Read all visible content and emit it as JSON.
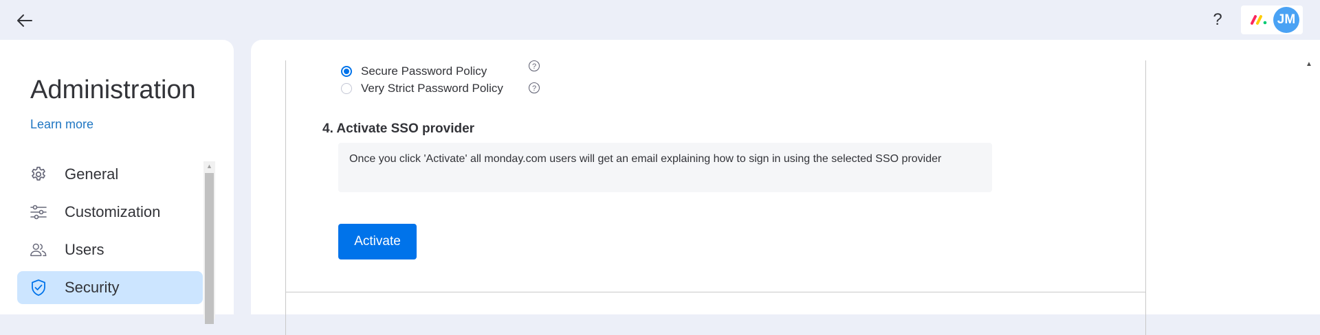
{
  "topbar": {
    "help_label": "?",
    "avatar_initials": "JM"
  },
  "sidebar": {
    "title": "Administration",
    "learn_more": "Learn more",
    "items": [
      {
        "label": "General",
        "icon": "gear-icon"
      },
      {
        "label": "Customization",
        "icon": "sliders-icon"
      },
      {
        "label": "Users",
        "icon": "users-icon"
      },
      {
        "label": "Security",
        "icon": "shield-icon",
        "active": true
      }
    ]
  },
  "main": {
    "password_options": [
      {
        "label": "Secure Password Policy",
        "selected": true
      },
      {
        "label": "Very Strict Password Policy",
        "selected": false
      }
    ],
    "step_title": "4. Activate SSO provider",
    "notice": "Once you click 'Activate' all monday.com users will get an email explaining how to sign in using the selected SSO provider",
    "activate_label": "Activate"
  },
  "colors": {
    "accent": "#0073ea",
    "active_nav_bg": "#cce5ff",
    "page_bg": "#eceff8",
    "avatar_bg": "#4aa2f4",
    "link": "#1f76c2"
  }
}
